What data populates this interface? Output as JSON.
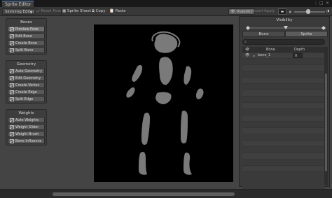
{
  "window": {
    "tab_title": "Sprite Editor",
    "controls": [
      "⋮",
      "□",
      "✕"
    ]
  },
  "toolbar": {
    "mode": "Skinning Editor",
    "reset_pose": "Reset Pose",
    "sprite_sheet": "Sprite Sheet",
    "copy": "Copy",
    "paste": "Paste",
    "visibility": "Visibility",
    "revert": "Revert",
    "apply": "Apply",
    "zoom_level": 0.45
  },
  "bones_panel": {
    "title": "Bones",
    "buttons": [
      {
        "label": "Preview Pose",
        "active": true
      },
      {
        "label": "Edit Bone",
        "active": false
      },
      {
        "label": "Create Bone",
        "active": false
      },
      {
        "label": "Split Bone",
        "active": false
      }
    ]
  },
  "geometry_panel": {
    "title": "Geometry",
    "buttons": [
      {
        "label": "Auto Geometry"
      },
      {
        "label": "Edit Geometry"
      },
      {
        "label": "Create Vertex"
      },
      {
        "label": "Create Edge"
      },
      {
        "label": "Split Edge"
      }
    ]
  },
  "weights_panel": {
    "title": "Weights",
    "buttons": [
      {
        "label": "Auto Weights"
      },
      {
        "label": "Weight Slider"
      },
      {
        "label": "Weight Brush"
      },
      {
        "label": "Bone Influence"
      }
    ]
  },
  "visibility_panel": {
    "title": "Visibility",
    "tabs": [
      "Bone",
      "Sprite"
    ],
    "selected_tab": "Sprite",
    "search_placeholder": "",
    "columns": {
      "bone": "Bone",
      "depth": "Depth"
    },
    "rows": [
      {
        "name": "bone_1",
        "depth": "0"
      }
    ]
  },
  "colors": {
    "sprite_fill": "#7a7a7a",
    "canvas_bg": "#000000",
    "editor_bg": "#444444"
  }
}
